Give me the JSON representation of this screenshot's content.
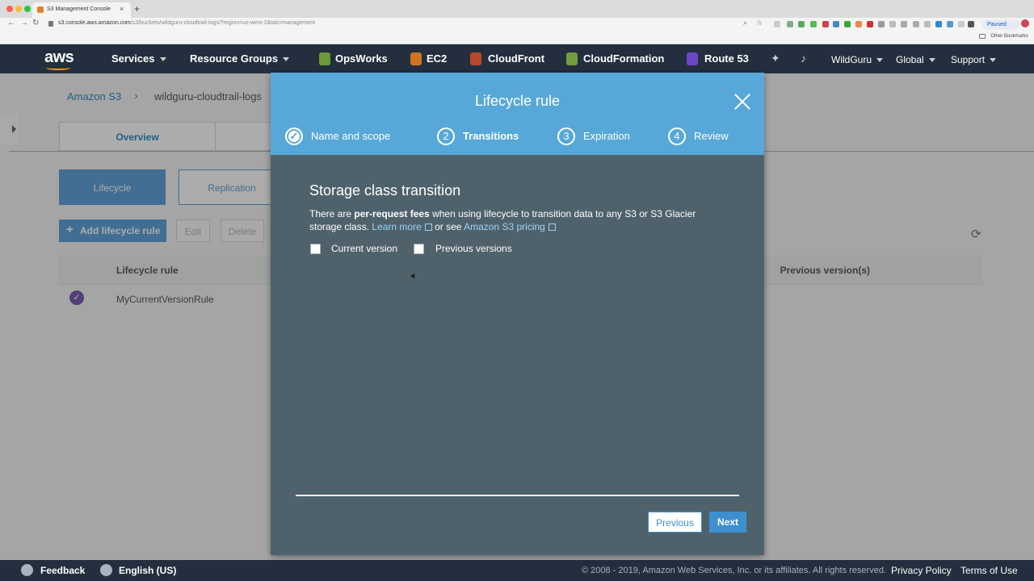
{
  "browser": {
    "tab_title": "S3 Management Console",
    "tab_close": "×",
    "new_tab": "+",
    "url_host": "s3.console.aws.amazon.com",
    "url_path": "/s3/buckets/wildguru-cloudtrail-logs/?region=us-west-2&tab=management",
    "paused_label": "Paused",
    "bookmarks_label": "Other Bookmarks"
  },
  "navbar": {
    "logo": "aws",
    "services": "Services",
    "resource_groups": "Resource Groups",
    "shortcuts": [
      "OpsWorks",
      "EC2",
      "CloudFront",
      "CloudFormation",
      "Route 53"
    ],
    "user": "WildGuru",
    "region": "Global",
    "support": "Support"
  },
  "page": {
    "breadcrumb_root": "Amazon S3",
    "breadcrumb_sep": "›",
    "breadcrumb_current": "wildguru-cloudtrail-logs",
    "tab_overview": "Overview",
    "subtab_lifecycle": "Lifecycle",
    "subtab_replication": "Replication",
    "add_rule": "Add lifecycle rule",
    "edit": "Edit",
    "delete": "Delete",
    "col_rule": "Lifecycle rule",
    "col_previous": "Previous version(s)",
    "row_rule": "MyCurrentVersionRule"
  },
  "modal": {
    "title": "Lifecycle rule",
    "steps": [
      {
        "num": "✓",
        "label": "Name and scope"
      },
      {
        "num": "2",
        "label": "Transitions"
      },
      {
        "num": "3",
        "label": "Expiration"
      },
      {
        "num": "4",
        "label": "Review"
      }
    ],
    "section_title": "Storage class transition",
    "desc_prefix": "There are ",
    "desc_bold": "per-request fees",
    "desc_mid": " when using lifecycle to transition data to any S3 or S3 Glacier storage class. ",
    "learn_more": "Learn more",
    "desc_or": " or see ",
    "pricing_link": "Amazon S3 pricing",
    "cb_current": "Current version",
    "cb_previous": "Previous versions",
    "btn_previous": "Previous",
    "btn_next": "Next"
  },
  "footer": {
    "feedback": "Feedback",
    "language": "English (US)",
    "copyright": "© 2008 - 2019, Amazon Web Services, Inc. or its affiliates. All rights reserved.",
    "privacy": "Privacy Policy",
    "terms": "Terms of Use"
  }
}
